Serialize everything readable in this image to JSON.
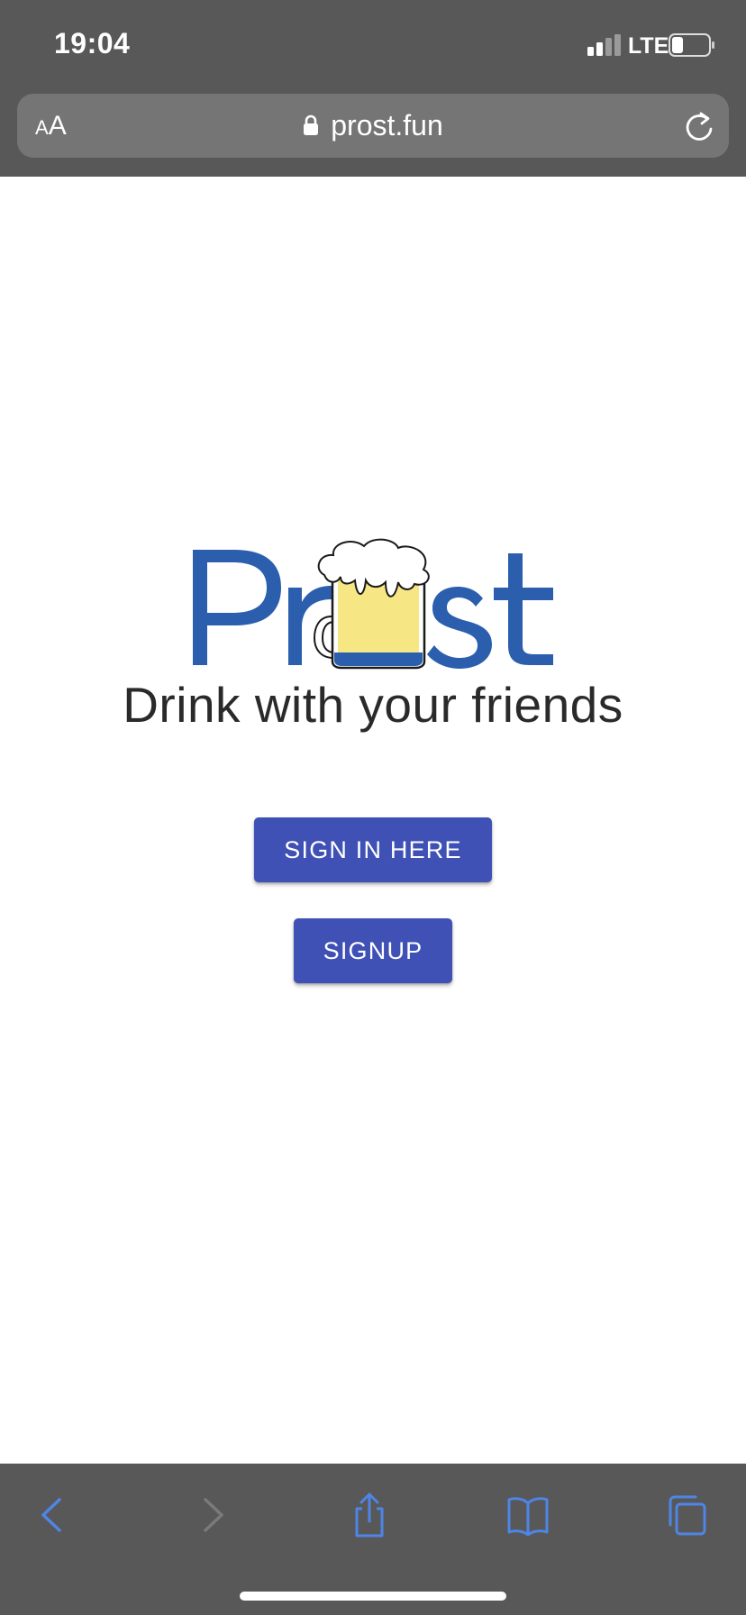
{
  "status_bar": {
    "time": "19:04",
    "network": "LTE"
  },
  "address_bar": {
    "text_size_small": "A",
    "text_size_large": "A",
    "url": "prost.fun"
  },
  "page": {
    "tagline": "Drink with your friends",
    "sign_in_label": "SIGN IN HERE",
    "signup_label": "SIGNUP"
  },
  "toolbar": {
    "icons": [
      "back-icon",
      "forward-icon",
      "share-icon",
      "bookmarks-icon",
      "tabs-icon"
    ]
  },
  "colors": {
    "chrome": "#585858",
    "address_bar": "#757575",
    "button": "#3f51b5",
    "logo_blue": "#2b5fae",
    "toolbar_icon_active": "#4e85e6",
    "toolbar_icon_disabled": "#7a7a7a"
  }
}
